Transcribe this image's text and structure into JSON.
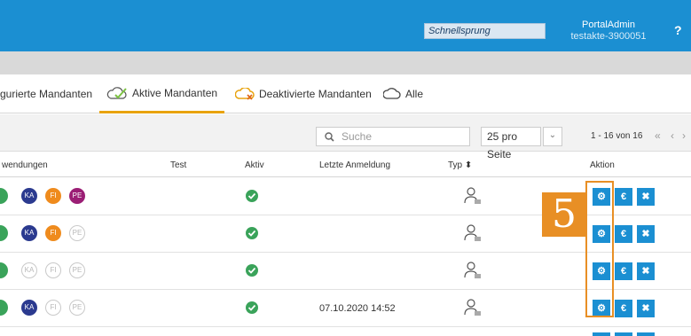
{
  "header": {
    "quick_jump": "Schnellsprung",
    "user_name": "PortalAdmin",
    "user_sub": "testakte-3900051",
    "help": "?"
  },
  "tabs": [
    {
      "label": "gurierte Mandanten"
    },
    {
      "label": "Aktive Mandanten",
      "active": true
    },
    {
      "label": "Deaktivierte Mandanten"
    },
    {
      "label": "Alle"
    }
  ],
  "toolbar": {
    "search_placeholder": "Suche",
    "per_page": "25 pro Seite",
    "page_info": "1 - 16 von 16",
    "pager": [
      "«",
      "‹",
      "›"
    ]
  },
  "columns": [
    "wendungen",
    "Test",
    "Aktiv",
    "Letzte Anmeldung",
    "Typ ⬍",
    "Aktion"
  ],
  "rows": [
    {
      "apps": {
        "KA": true,
        "FI": true,
        "PE": true
      },
      "aktiv": true,
      "letzte_anmeldung": ""
    },
    {
      "apps": {
        "KA": true,
        "FI": true,
        "PE": false
      },
      "aktiv": true,
      "letzte_anmeldung": ""
    },
    {
      "apps": {
        "KA": false,
        "FI": false,
        "PE": false
      },
      "aktiv": true,
      "letzte_anmeldung": ""
    },
    {
      "apps": {
        "KA": true,
        "FI": false,
        "PE": false
      },
      "aktiv": true,
      "letzte_anmeldung": "07.10.2020 14:52"
    }
  ],
  "app_labels": {
    "ka": "KA",
    "fi": "FI",
    "pe": "PE"
  },
  "actions": {
    "settings": "⚙",
    "billing": "€",
    "delete": "✖"
  },
  "annotation": {
    "number": "5"
  },
  "colors": {
    "primary": "#1b8fd2",
    "accent": "#e8a30e",
    "annotation": "#e88f25",
    "ka": "#2b3a8f",
    "fi": "#ef8b1d",
    "pe": "#9b1e75",
    "success": "#3aa35a"
  }
}
